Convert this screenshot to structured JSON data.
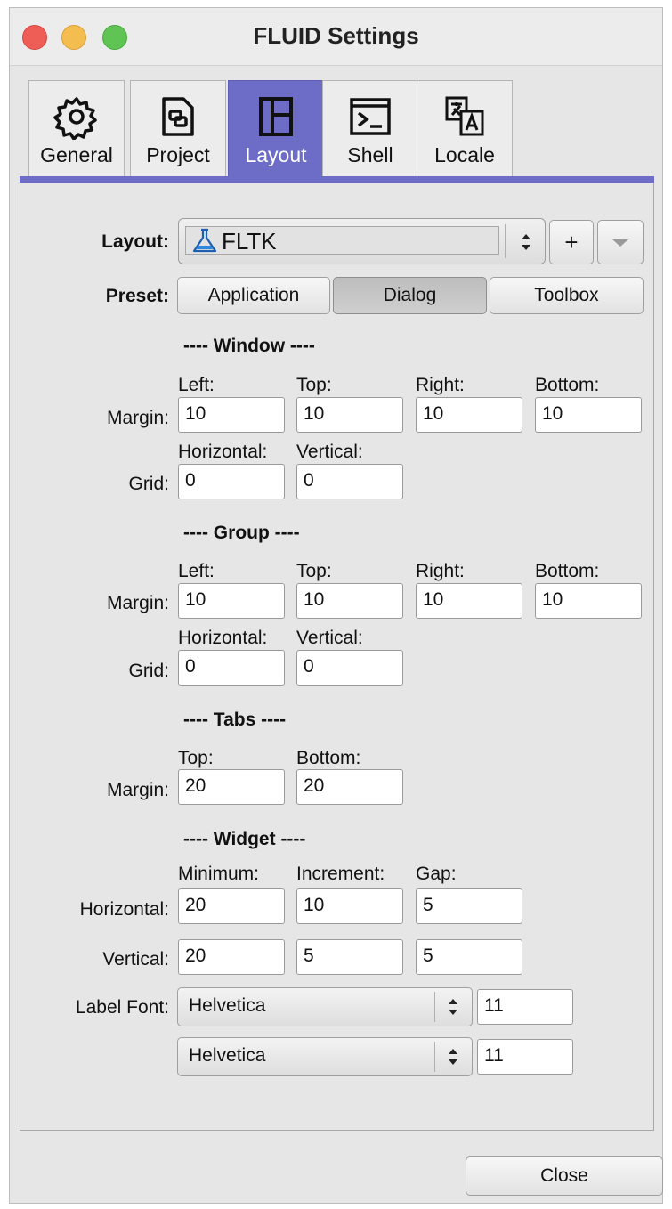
{
  "window": {
    "title": "FLUID Settings"
  },
  "tabs": [
    {
      "label": "General",
      "icon": "gear-icon"
    },
    {
      "label": "Project",
      "icon": "project-icon"
    },
    {
      "label": "Layout",
      "icon": "layout-icon",
      "active": true
    },
    {
      "label": "Shell",
      "icon": "terminal-icon"
    },
    {
      "label": "Locale",
      "icon": "translate-icon"
    }
  ],
  "layout_row": {
    "label": "Layout:",
    "value": "FLTK",
    "add_label": "+"
  },
  "preset_row": {
    "label": "Preset:",
    "options": [
      "Application",
      "Dialog",
      "Toolbox"
    ],
    "selected": "Dialog"
  },
  "window_section": {
    "heading": "---- Window ----",
    "margin_label": "Margin:",
    "grid_label": "Grid:",
    "margin_headers": [
      "Left:",
      "Top:",
      "Right:",
      "Bottom:"
    ],
    "margin_values": [
      "10",
      "10",
      "10",
      "10"
    ],
    "grid_headers": [
      "Horizontal:",
      "Vertical:"
    ],
    "grid_values": [
      "0",
      "0"
    ]
  },
  "group_section": {
    "heading": "---- Group ----",
    "margin_label": "Margin:",
    "grid_label": "Grid:",
    "margin_headers": [
      "Left:",
      "Top:",
      "Right:",
      "Bottom:"
    ],
    "margin_values": [
      "10",
      "10",
      "10",
      "10"
    ],
    "grid_headers": [
      "Horizontal:",
      "Vertical:"
    ],
    "grid_values": [
      "0",
      "0"
    ]
  },
  "tabs_section": {
    "heading": "---- Tabs ----",
    "margin_label": "Margin:",
    "headers": [
      "Top:",
      "Bottom:"
    ],
    "values": [
      "20",
      "20"
    ]
  },
  "widget_section": {
    "heading": "---- Widget ----",
    "headers": [
      "Minimum:",
      "Increment:",
      "Gap:"
    ],
    "horizontal_label": "Horizontal:",
    "horizontal_values": [
      "20",
      "10",
      "5"
    ],
    "vertical_label": "Vertical:",
    "vertical_values": [
      "20",
      "5",
      "5"
    ],
    "label_font_label": "Label Font:",
    "label_font": "Helvetica",
    "label_size": "11",
    "text_font": "Helvetica",
    "text_size": "11"
  },
  "footer": {
    "close_label": "Close"
  }
}
